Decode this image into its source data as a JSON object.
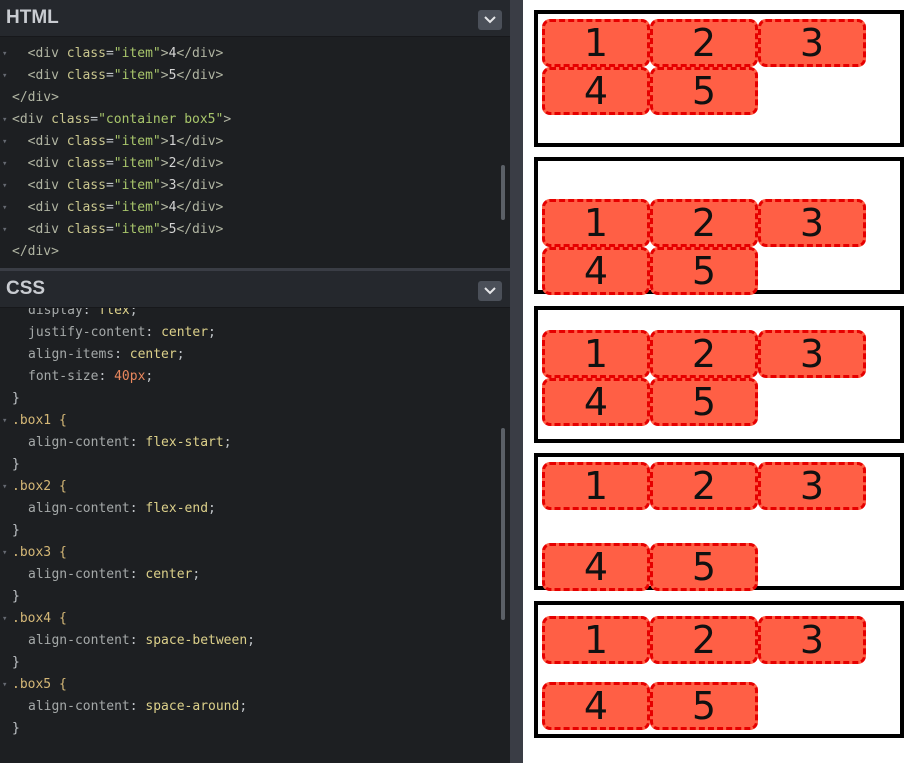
{
  "html_panel": {
    "title": "HTML",
    "lines": [
      {
        "fold": true,
        "indent": "  ",
        "attr": "class",
        "cls": "\"item\"",
        "text": "4"
      },
      {
        "fold": true,
        "indent": "  ",
        "attr": "class",
        "cls": "\"item\"",
        "text": "5"
      },
      {
        "close": "</div>",
        "indent": ""
      },
      {
        "fold": true,
        "indent": "",
        "attr": "class",
        "cls": "\"container box5\"",
        "open_only": true
      },
      {
        "fold": true,
        "indent": "  ",
        "attr": "class",
        "cls": "\"item\"",
        "text": "1"
      },
      {
        "fold": true,
        "indent": "  ",
        "attr": "class",
        "cls": "\"item\"",
        "text": "2"
      },
      {
        "fold": true,
        "indent": "  ",
        "attr": "class",
        "cls": "\"item\"",
        "text": "3"
      },
      {
        "fold": true,
        "indent": "  ",
        "attr": "class",
        "cls": "\"item\"",
        "text": "4"
      },
      {
        "fold": true,
        "indent": "  ",
        "attr": "class",
        "cls": "\"item\"",
        "text": "5"
      },
      {
        "close": "</div>",
        "indent": ""
      }
    ]
  },
  "css_panel": {
    "title": "CSS",
    "lines": [
      {
        "kind": "decl",
        "prop": "display",
        "val": "flex",
        "partial": true
      },
      {
        "kind": "decl",
        "prop": "justify-content",
        "val": "center"
      },
      {
        "kind": "decl",
        "prop": "align-items",
        "val": "center"
      },
      {
        "kind": "decl",
        "prop": "font-size",
        "num": "40px"
      },
      {
        "kind": "close",
        "text": "}"
      },
      {
        "kind": "sel",
        "text": ".box1 {"
      },
      {
        "kind": "decl",
        "prop": "align-content",
        "val": "flex-start"
      },
      {
        "kind": "close",
        "text": "}"
      },
      {
        "kind": "sel",
        "text": ".box2 {"
      },
      {
        "kind": "decl",
        "prop": "align-content",
        "val": "flex-end"
      },
      {
        "kind": "close",
        "text": "}"
      },
      {
        "kind": "sel",
        "text": ".box3 {"
      },
      {
        "kind": "decl",
        "prop": "align-content",
        "val": "center"
      },
      {
        "kind": "close",
        "text": "}"
      },
      {
        "kind": "sel",
        "text": ".box4 {"
      },
      {
        "kind": "decl",
        "prop": "align-content",
        "val": "space-between"
      },
      {
        "kind": "close",
        "text": "}"
      },
      {
        "kind": "sel",
        "text": ".box5 {"
      },
      {
        "kind": "decl",
        "prop": "align-content",
        "val": "space-around"
      },
      {
        "kind": "close",
        "text": "}"
      }
    ]
  },
  "preview": {
    "items": [
      "1",
      "2",
      "3",
      "4",
      "5"
    ]
  },
  "colors": {
    "editor_bg": "#1d1f22",
    "item_fill": "#ff5f45",
    "item_border": "#e60000",
    "box_border": "#000000"
  }
}
